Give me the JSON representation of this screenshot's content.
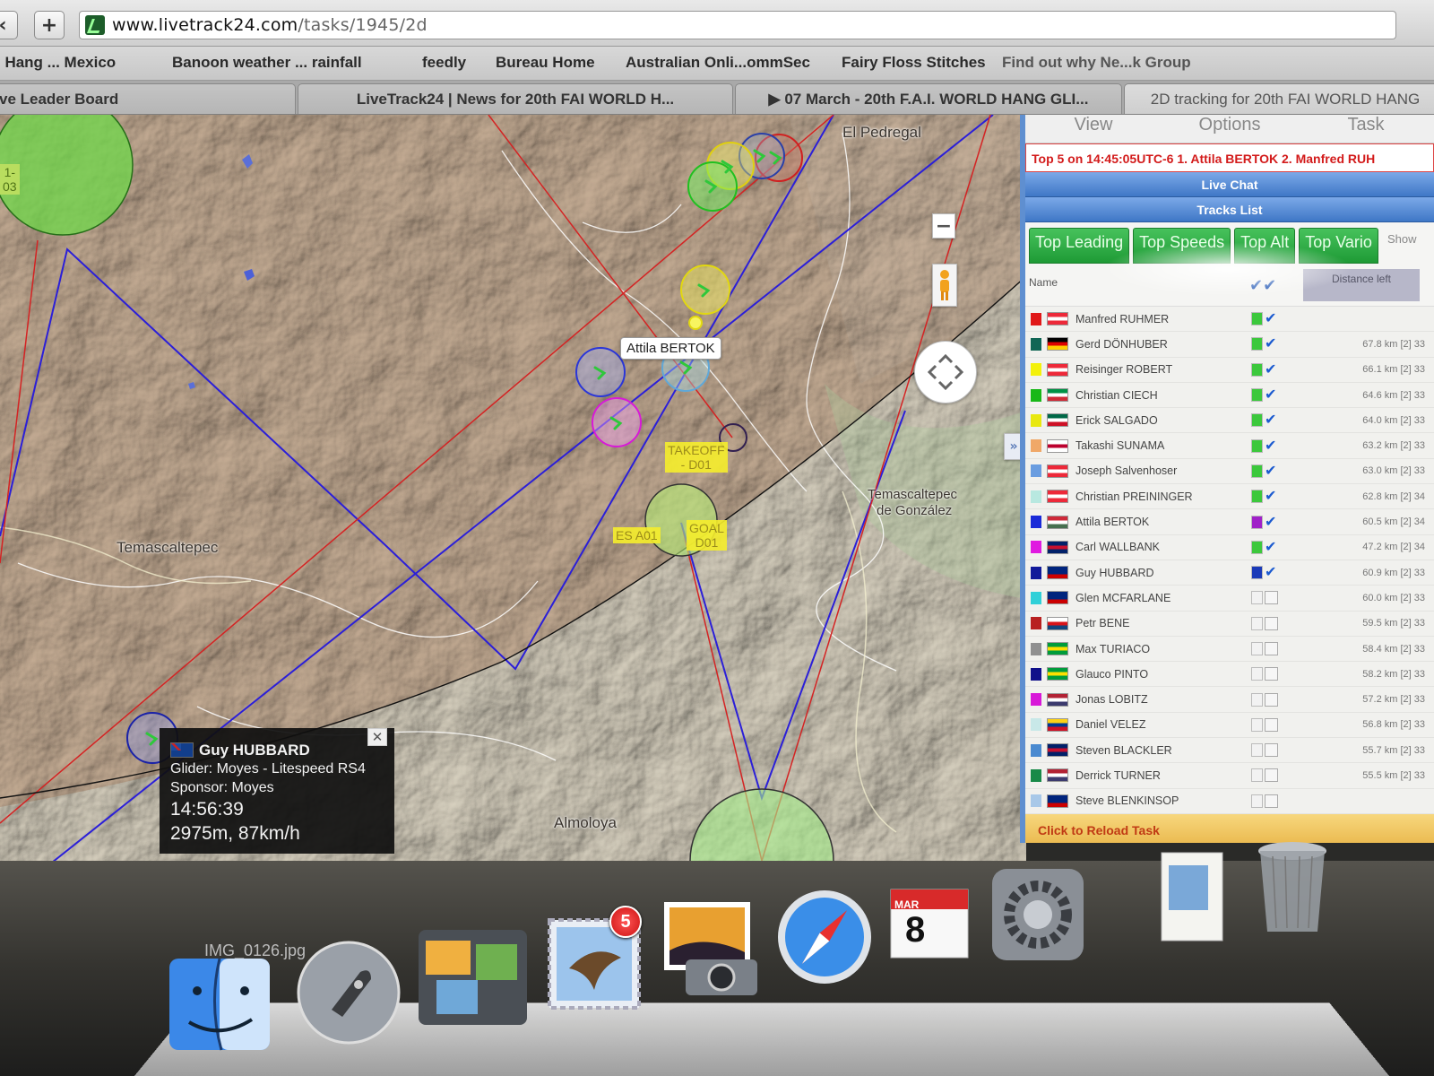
{
  "browser": {
    "url_host": "www.livetrack24.com",
    "url_path": "/tasks/1945/2d",
    "bookmarks": [
      "I Hang ... Mexico",
      "Banoon weather ... rainfall",
      "feedly",
      "Bureau Home",
      "Australian Onli...ommSec",
      "Fairy Floss Stitches",
      "Find out why Ne...k Group"
    ],
    "tabs": [
      "ve Leader Board",
      "LiveTrack24 | News for 20th FAI WORLD H...",
      "▶ 07 March - 20th F.A.I. WORLD HANG GLI...",
      "2D tracking for 20th FAI WORLD HANG"
    ]
  },
  "map": {
    "places": {
      "el_pedregal": "El Pedregal",
      "temascaltepec": "Temascaltepec",
      "temascaltepec_gonzalez_1": "Temascaltepec",
      "temascaltepec_gonzalez_2": "de González",
      "almoloya": "Almoloya"
    },
    "waypoints": {
      "takeoff_1": "TAKEOFF",
      "takeoff_2": "- D01",
      "es": "ES",
      "a01": "A01",
      "goal_1": "GOAL",
      "goal_2": "D01",
      "edge_1": "1-",
      "edge_2": "03"
    },
    "pilot_label": "Attila BERTOK",
    "infobox": {
      "name": "Guy HUBBARD",
      "glider": "Glider: Moyes - Litespeed RS4",
      "sponsor": "Sponsor: Moyes",
      "time": "14:56:39",
      "alt_speed": "2975m, 87km/h",
      "close": "✕"
    },
    "zoom_out": "−"
  },
  "sidebar": {
    "menu": [
      "View",
      "Options",
      "Task"
    ],
    "ticker": "Top 5 on 14:45:05UTC-6 1. Attila BERTOK 2. Manfred RUH",
    "live_chat": "Live Chat",
    "tracks_list": "Tracks List",
    "tabs": [
      "Top Leading",
      "Top Speeds",
      "Top Alt",
      "Top Vario"
    ],
    "tab_more": "Show",
    "header_name": "Name",
    "header_distance": "Distance left",
    "reload": "Click to Reload Task",
    "pilots": [
      {
        "name": "Manfred RUHMER",
        "color": "#e01818",
        "checked": true,
        "dist": "",
        "flag": "at"
      },
      {
        "name": "Gerd DÖNHUBER",
        "color": "#116655",
        "checked": true,
        "dist": "67.8 km [2] 33",
        "flag": "de"
      },
      {
        "name": "Reisinger ROBERT",
        "color": "#f3f10b",
        "checked": true,
        "dist": "66.1 km [2] 33",
        "flag": "at"
      },
      {
        "name": "Christian CIECH",
        "color": "#18b818",
        "checked": true,
        "dist": "64.6 km [2] 33",
        "flag": "it"
      },
      {
        "name": "Erick SALGADO",
        "color": "#e8e80f",
        "checked": true,
        "dist": "64.0 km [2] 33",
        "flag": "mx"
      },
      {
        "name": "Takashi SUNAMA",
        "color": "#f0a868",
        "checked": true,
        "dist": "63.2 km [2] 33",
        "flag": "jp"
      },
      {
        "name": "Joseph Salvenhoser",
        "color": "#6a9de0",
        "checked": true,
        "dist": "63.0 km [2] 33",
        "flag": "at"
      },
      {
        "name": "Christian PREININGER",
        "color": "#b8e8e0",
        "checked": true,
        "dist": "62.8 km [2] 34",
        "flag": "at"
      },
      {
        "name": "Attila BERTOK",
        "color": "#1a2ad8",
        "checked": true,
        "dist": "60.5 km [2] 34",
        "flag": "hu"
      },
      {
        "name": "Carl WALLBANK",
        "color": "#e01ae0",
        "checked": true,
        "dist": "47.2 km [2] 34",
        "flag": "gb"
      },
      {
        "name": "Guy HUBBARD",
        "color": "#121a9a",
        "checked": true,
        "dist": "60.9 km [2] 33",
        "flag": "au"
      },
      {
        "name": "Glen MCFARLANE",
        "color": "#30d0d8",
        "checked": false,
        "dist": "60.0 km [2] 33",
        "flag": "au"
      },
      {
        "name": "Petr BENE",
        "color": "#b82020",
        "checked": false,
        "dist": "59.5 km [2] 33",
        "flag": "cz"
      },
      {
        "name": "Max TURIACO",
        "color": "#909090",
        "checked": false,
        "dist": "58.4 km [2] 33",
        "flag": "br"
      },
      {
        "name": "Glauco PINTO",
        "color": "#10108a",
        "checked": false,
        "dist": "58.2 km [2] 33",
        "flag": "br"
      },
      {
        "name": "Jonas LOBITZ",
        "color": "#d818d8",
        "checked": false,
        "dist": "57.2 km [2] 33",
        "flag": "us"
      },
      {
        "name": "Daniel VELEZ",
        "color": "#c8e8e8",
        "checked": false,
        "dist": "56.8 km [2] 33",
        "flag": "co"
      },
      {
        "name": "Steven BLACKLER",
        "color": "#4a8ad0",
        "checked": false,
        "dist": "55.7 km [2] 33",
        "flag": "gb"
      },
      {
        "name": "Derrick TURNER",
        "color": "#188a48",
        "checked": false,
        "dist": "55.5 km [2] 33",
        "flag": "us"
      },
      {
        "name": "Steve BLENKINSOP",
        "color": "#a8c8e8",
        "checked": false,
        "dist": "",
        "flag": "au"
      }
    ]
  },
  "dock": {
    "file_label": "IMG_0126.jpg",
    "mail_badge": "5",
    "calendar_month": "MAR",
    "calendar_day": "8"
  }
}
